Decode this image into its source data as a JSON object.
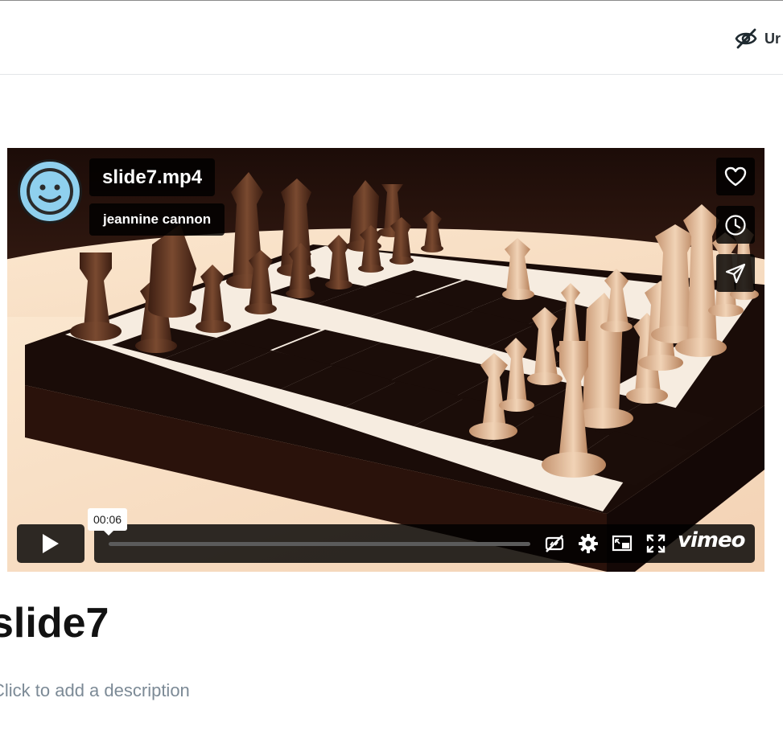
{
  "header": {
    "visibility_label": "Ur"
  },
  "video": {
    "title": "slide7.mp4",
    "author": "jeannine cannon",
    "current_time": "00:06",
    "progress": 0.0,
    "logo_text": "vimeo"
  },
  "icons": {
    "visibility": "eye-off-icon",
    "like": "heart-icon",
    "watch_later": "clock-icon",
    "share": "send-icon",
    "play": "play-icon",
    "cc": "captions-off-icon",
    "settings": "gear-icon",
    "pip": "picture-in-picture-icon",
    "fullscreen": "fullscreen-icon"
  },
  "page": {
    "title": "slide7",
    "description_placeholder": "Click to add a description"
  },
  "colors": {
    "avatar_bg": "#8fd0ee",
    "overlay_bg": "rgba(0,0,0,0.82)",
    "text_muted": "#7c8a96"
  }
}
